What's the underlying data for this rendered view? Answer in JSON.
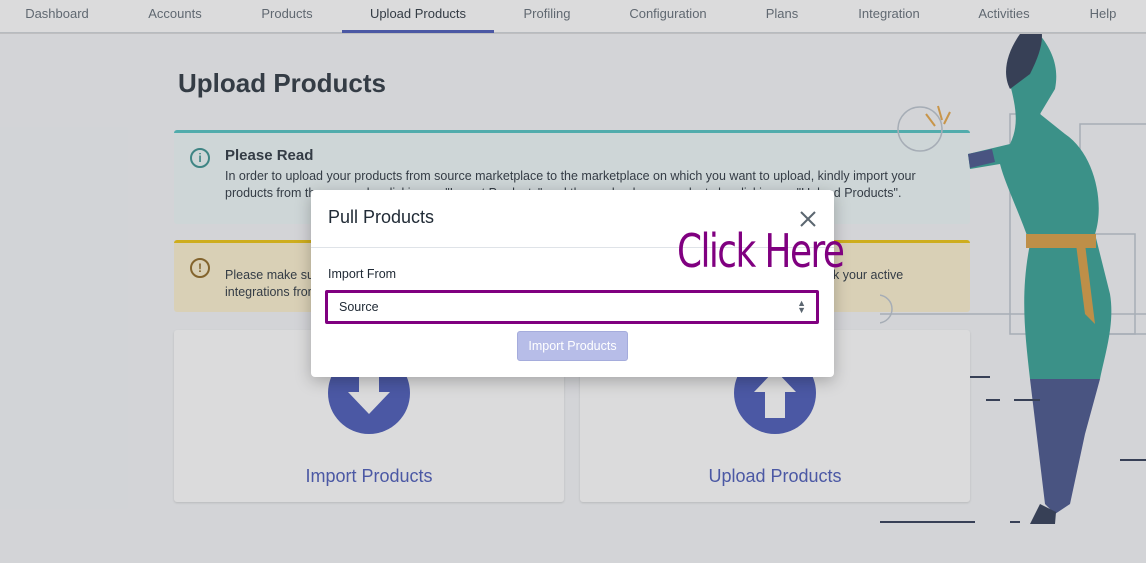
{
  "nav": {
    "items": [
      {
        "label": "Dashboard"
      },
      {
        "label": "Accounts"
      },
      {
        "label": "Products"
      },
      {
        "label": "Upload Products"
      },
      {
        "label": "Profiling"
      },
      {
        "label": "Configuration"
      },
      {
        "label": "Plans"
      },
      {
        "label": "Integration"
      },
      {
        "label": "Activities"
      },
      {
        "label": "Help"
      }
    ],
    "active": "Upload Products"
  },
  "page": {
    "title": "Upload Products",
    "info_banner": {
      "title": "Please Read",
      "icon": "info-icon",
      "text": "In order to upload your products from source marketplace to the marketplace on which you want to upload, kindly import your products from the source by clicking on \"Import Products\" and then upload your products by clicking on \"Upload Products\"."
    },
    "warning_banner": {
      "icon": "warning-icon",
      "text": "Please make sure you have connected your accounts on the platform before proceeding further. You can check your active integrations from the Integration section."
    },
    "cards": [
      {
        "label": "Import Products",
        "icon": "arrow-down-icon"
      },
      {
        "label": "Upload Products",
        "icon": "arrow-up-icon"
      }
    ]
  },
  "modal": {
    "title": "Pull Products",
    "close_icon": "close-icon",
    "field_label": "Import From",
    "select_value": "Source",
    "button_label": "Import Products"
  },
  "annotation": {
    "text": "Click Here",
    "color": "#800080"
  },
  "colors": {
    "accent": "#3f51b5",
    "info": "#47c1bf",
    "warning": "#eec200",
    "highlight": "#800080"
  }
}
